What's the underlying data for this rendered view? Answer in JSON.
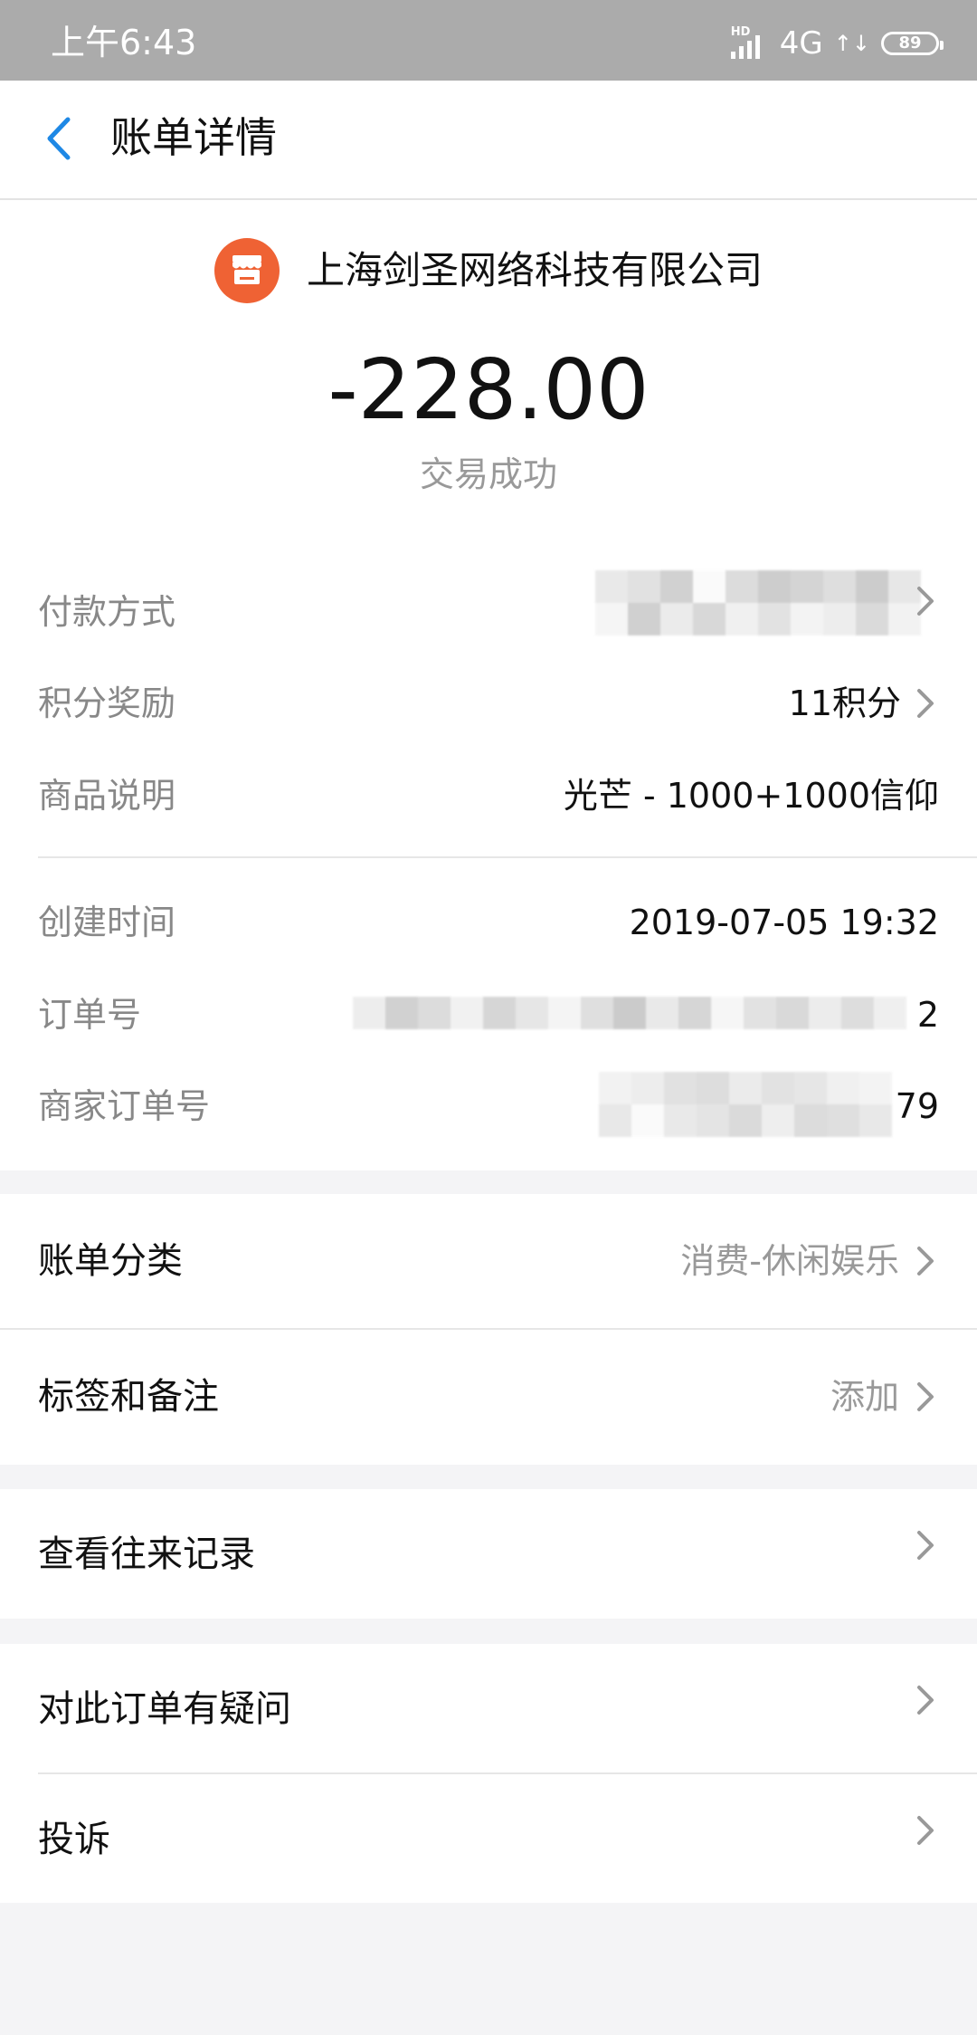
{
  "status_bar": {
    "time": "上午6:43",
    "hd": "HD",
    "network": "4G",
    "data_arrows": "↑↓",
    "battery": "89"
  },
  "nav": {
    "title": "账单详情"
  },
  "merchant": {
    "name": "上海剑圣网络科技有限公司",
    "icon": "store-icon",
    "icon_color": "#ef6234"
  },
  "transaction": {
    "amount": "-228.00",
    "status": "交易成功"
  },
  "details": {
    "payment_method": {
      "label": "付款方式",
      "value": ""
    },
    "points": {
      "label": "积分奖励",
      "value": "11积分"
    },
    "product": {
      "label": "商品说明",
      "value": "光芒 - 1000+1000信仰"
    },
    "created": {
      "label": "创建时间",
      "value": "2019-07-05 19:32"
    },
    "order_no": {
      "label": "订单号",
      "value_tail": "2"
    },
    "merchant_order_no": {
      "label": "商家订单号",
      "value_tail": "79"
    }
  },
  "category": {
    "label": "账单分类",
    "value": "消费-休闲娱乐"
  },
  "tags": {
    "label": "标签和备注",
    "value": "添加"
  },
  "history": {
    "label": "查看往来记录"
  },
  "question": {
    "label": "对此订单有疑问"
  },
  "complaint": {
    "label": "投诉"
  },
  "colors": {
    "accent": "#1e88e5",
    "background": "#f4f4f6"
  }
}
